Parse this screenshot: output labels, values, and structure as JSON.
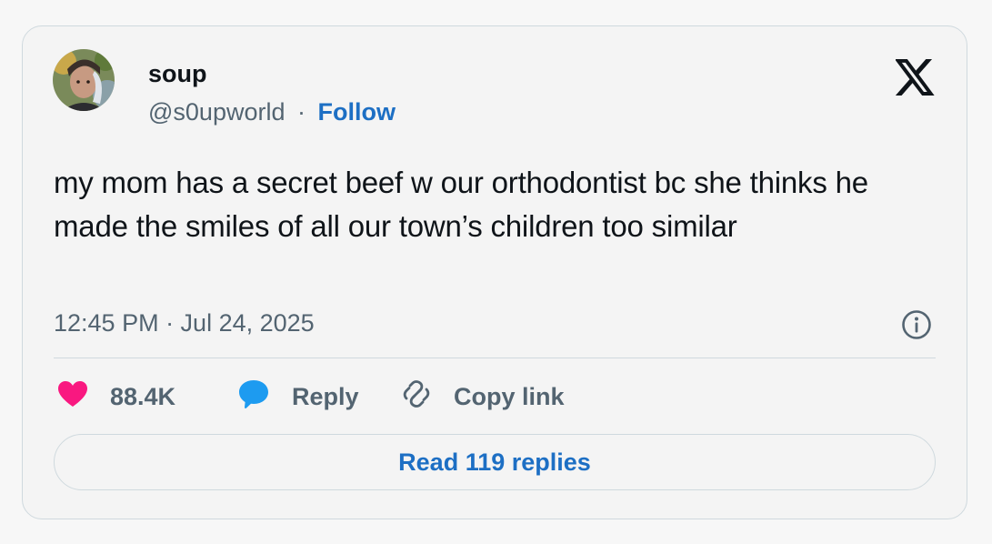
{
  "author": {
    "name": "soup",
    "handle": "@s0upworld",
    "separator": "·",
    "follow_label": "Follow",
    "avatar_icon": "profile-photo"
  },
  "brand": {
    "logo_icon": "x-logo-icon"
  },
  "tweet": {
    "text": "my mom has a secret beef w our orthodontist bc she thinks he made the smiles of all our town’s children too similar",
    "timestamp": "12:45 PM · Jul 24, 2025"
  },
  "actions": {
    "like_count": "88.4K",
    "reply_label": "Reply",
    "copy_link_label": "Copy link"
  },
  "footer": {
    "read_replies_label": "Read 119 replies"
  },
  "colors": {
    "link_blue": "#1d6fc4",
    "heart_pink": "#f91880",
    "reply_blue": "#1d9bf0",
    "secondary_text": "#536471",
    "border": "#cfd9de"
  }
}
